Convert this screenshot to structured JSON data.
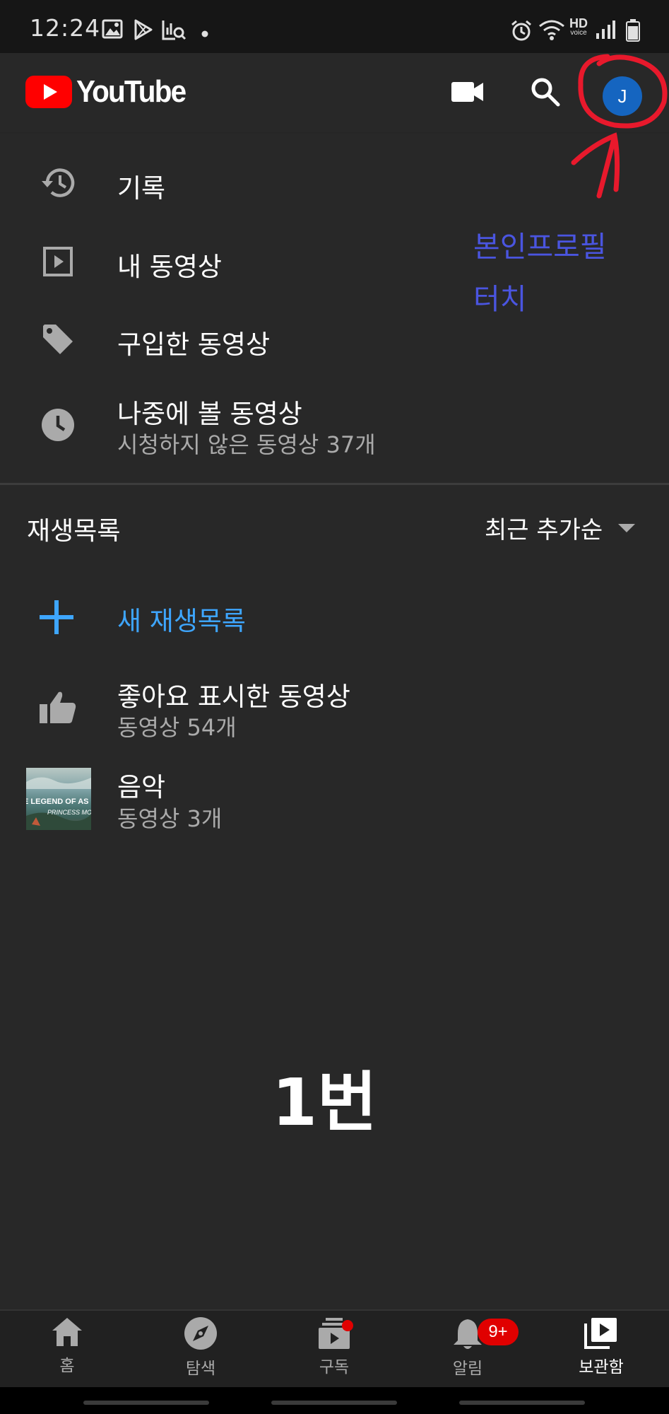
{
  "status_bar": {
    "time": "12:24",
    "icons_left": [
      "image-icon",
      "play-store-icon",
      "chart-search-icon",
      "dot-icon"
    ],
    "icons_right": [
      "alarm-icon",
      "wifi-icon",
      "hd-voice-icon",
      "signal-icon",
      "battery-icon"
    ],
    "hd_label": "HD",
    "voice_label": "voice"
  },
  "app_bar": {
    "logo_text": "YouTube",
    "avatar_initial": "J",
    "brand_color": "#ff0000"
  },
  "library": {
    "items": [
      {
        "title": "기록",
        "icon": "history-icon"
      },
      {
        "title": "내 동영상",
        "icon": "video-icon"
      },
      {
        "title": "구입한 동영상",
        "icon": "tag-icon"
      },
      {
        "title": "나중에 볼 동영상",
        "subtitle": "시청하지 않은 동영상 37개",
        "icon": "clock-icon"
      }
    ]
  },
  "playlists": {
    "heading": "재생목록",
    "sort_label": "최근 추가순",
    "new_playlist_label": "새 재생목록",
    "accent_color": "#3ea6ff",
    "items": [
      {
        "title": "좋아요 표시한 동영상",
        "subtitle": "동영상 54개",
        "icon": "thumbs-up-icon"
      },
      {
        "title": "음악",
        "subtitle": "동영상 3개",
        "thumbnail_text_1": "E LEGEND OF AS",
        "thumbnail_text_2": "PRINCESS MO"
      }
    ]
  },
  "annotations": {
    "line1": "본인프로필",
    "line2": "터치",
    "number": "1번",
    "circle_color": "#e8192c",
    "text_color": "#4a55e0"
  },
  "bottom_nav": {
    "items": [
      {
        "label": "홈",
        "icon": "home-icon"
      },
      {
        "label": "탐색",
        "icon": "compass-icon"
      },
      {
        "label": "구독",
        "icon": "subscriptions-icon"
      },
      {
        "label": "알림",
        "icon": "bell-icon"
      },
      {
        "label": "보관함",
        "icon": "library-icon",
        "active": true
      }
    ],
    "notification_badge": "9+"
  }
}
